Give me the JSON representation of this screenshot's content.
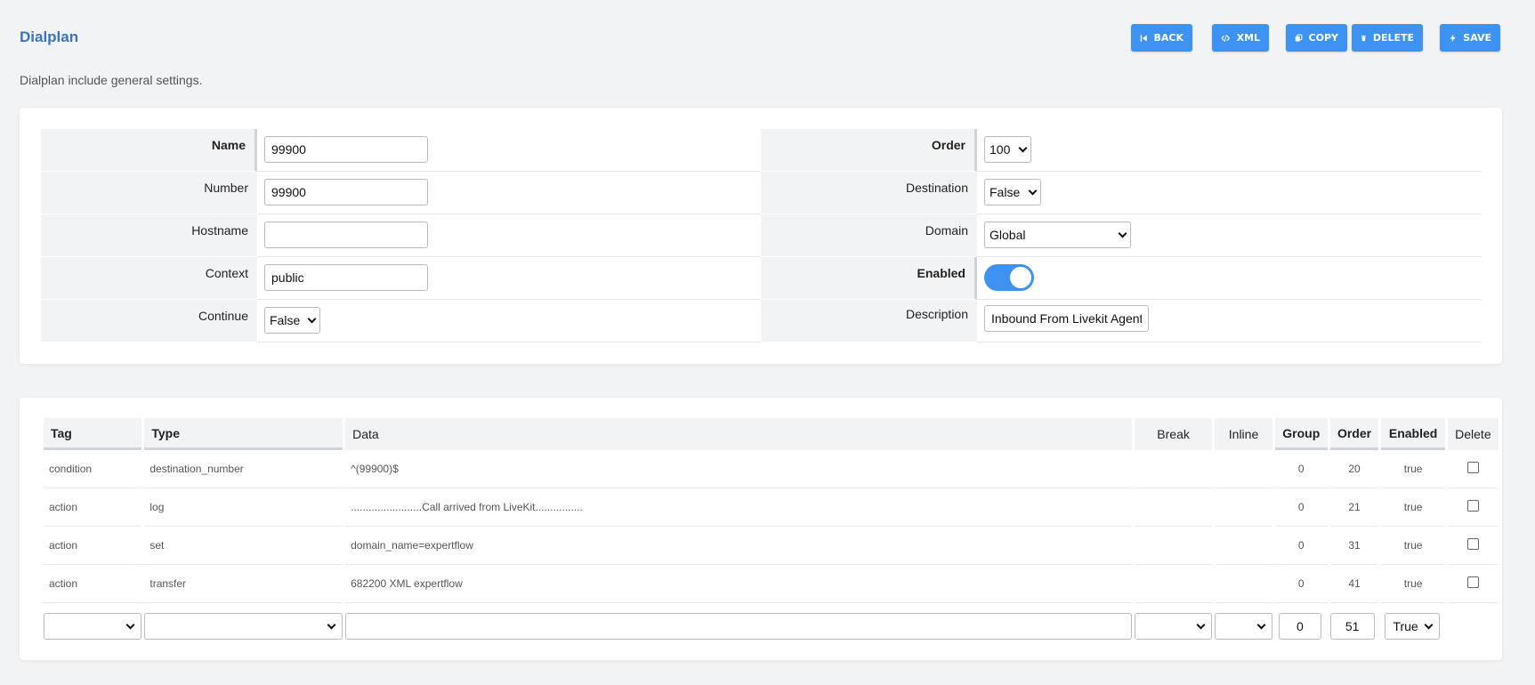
{
  "page": {
    "title": "Dialplan",
    "description": "Dialplan include general settings."
  },
  "toolbar": {
    "back_label": "BACK",
    "xml_label": "XML",
    "copy_label": "COPY",
    "delete_label": "DELETE",
    "save_label": "SAVE",
    "accent_color": "#3d92f2"
  },
  "form": {
    "name_label": "Name",
    "name_value": "99900",
    "number_label": "Number",
    "number_value": "99900",
    "hostname_label": "Hostname",
    "hostname_value": "",
    "context_label": "Context",
    "context_value": "public",
    "continue_label": "Continue",
    "continue_value": "False",
    "order_label": "Order",
    "order_value": "100",
    "destination_label": "Destination",
    "destination_value": "False",
    "domain_label": "Domain",
    "domain_value": "Global",
    "enabled_label": "Enabled",
    "enabled_value": true,
    "description_label": "Description",
    "description_value": "Inbound From Livekit Agent"
  },
  "details": {
    "headers": [
      "Tag",
      "Type",
      "Data",
      "Break",
      "Inline",
      "Group",
      "Order",
      "Enabled",
      "Delete"
    ],
    "rows": [
      {
        "tag": "condition",
        "type": "destination_number",
        "data": "^(99900)$",
        "break": "",
        "inline": "",
        "group": "0",
        "order": "20",
        "enabled": "true"
      },
      {
        "tag": "action",
        "type": "log",
        "data": "........................Call arrived from LiveKit................",
        "break": "",
        "inline": "",
        "group": "0",
        "order": "21",
        "enabled": "true"
      },
      {
        "tag": "action",
        "type": "set",
        "data": "domain_name=expertflow",
        "break": "",
        "inline": "",
        "group": "0",
        "order": "31",
        "enabled": "true"
      },
      {
        "tag": "action",
        "type": "transfer",
        "data": "682200 XML expertflow",
        "break": "",
        "inline": "",
        "group": "0",
        "order": "41",
        "enabled": "true"
      }
    ],
    "new_row": {
      "group": "0",
      "order": "51",
      "enabled": "True"
    }
  }
}
